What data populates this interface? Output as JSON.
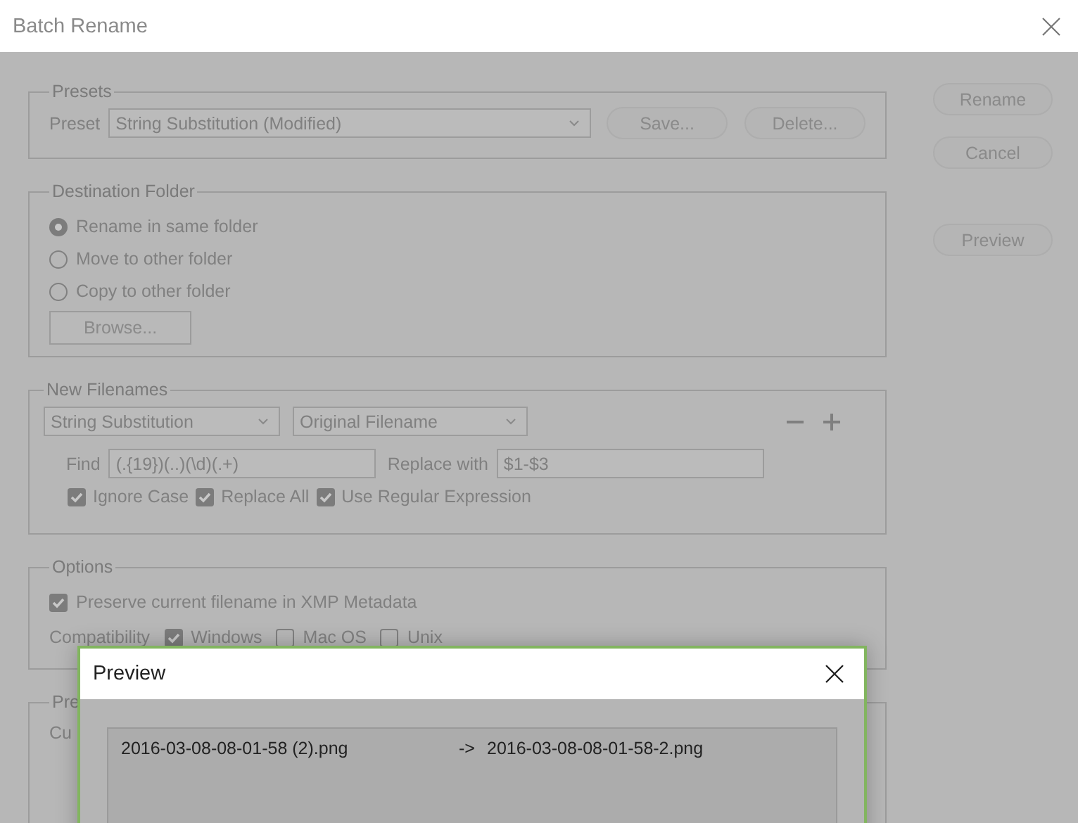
{
  "window": {
    "title": "Batch Rename"
  },
  "actions": [
    {
      "label": "Rename"
    },
    {
      "label": "Cancel"
    },
    {
      "label": "Preview"
    }
  ],
  "presets": {
    "legend": "Presets",
    "label": "Preset",
    "value": "String Substitution (Modified)",
    "buttons": [
      "Save...",
      "Delete..."
    ]
  },
  "destination": {
    "legend": "Destination Folder",
    "options": [
      {
        "label": "Rename in same folder",
        "selected": true
      },
      {
        "label": "Move to other folder",
        "selected": false
      },
      {
        "label": "Copy to other folder",
        "selected": false
      }
    ],
    "browse": "Browse..."
  },
  "new_filenames": {
    "legend": "New Filenames",
    "type_value": "String Substitution",
    "source_value": "Original Filename",
    "find_label": "Find",
    "find_value": "(.{19})(..)(\\d)(.+)",
    "replace_label": "Replace with",
    "replace_value": "$1-$3",
    "options": [
      {
        "label": "Ignore Case",
        "checked": true
      },
      {
        "label": "Replace All",
        "checked": true
      },
      {
        "label": "Use Regular Expression",
        "checked": true
      }
    ]
  },
  "options": {
    "legend": "Options",
    "preserve": {
      "label": "Preserve current filename in XMP Metadata",
      "checked": true
    },
    "compatibility_label": "Compatibility",
    "compatibility": [
      {
        "label": "Windows",
        "checked": true
      },
      {
        "label": "Mac OS",
        "checked": false
      },
      {
        "label": "Unix",
        "checked": false
      }
    ]
  },
  "preview_group": {
    "legend": "Pre",
    "row_1_label": "Cu"
  },
  "preview_dialog": {
    "title": "Preview",
    "rows": [
      {
        "original": "2016-03-08-08-01-58 (2).png",
        "arrow": "->",
        "renamed": "2016-03-08-08-01-58-2.png"
      }
    ]
  }
}
